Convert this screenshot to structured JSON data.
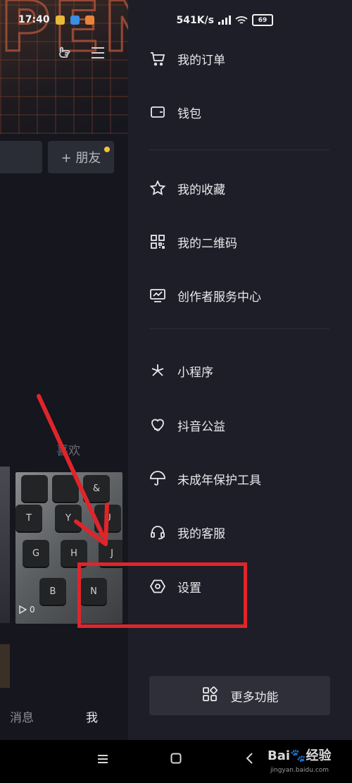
{
  "status_bar": {
    "time": "17:40",
    "network_speed": "541K/s",
    "battery": "69"
  },
  "profile_background": {
    "add_friend_label": "+ 朋友",
    "likes_label": "喜欢",
    "play_count": "0",
    "bottom_tabs": [
      "消息",
      "我"
    ]
  },
  "keyboard_thumb_keys": [
    "&",
    "T",
    "Y",
    "U",
    "G",
    "H",
    "J",
    "B",
    "N"
  ],
  "drawer": {
    "items": [
      {
        "label": "我的订单",
        "icon": "cart-icon"
      },
      {
        "label": "钱包",
        "icon": "wallet-icon"
      },
      {
        "label": "我的收藏",
        "icon": "star-icon"
      },
      {
        "label": "我的二维码",
        "icon": "qr-code-icon"
      },
      {
        "label": "创作者服务中心",
        "icon": "chart-monitor-icon"
      },
      {
        "label": "小程序",
        "icon": "mini-program-icon"
      },
      {
        "label": "抖音公益",
        "icon": "charity-heart-icon"
      },
      {
        "label": "未成年保护工具",
        "icon": "umbrella-icon"
      },
      {
        "label": "我的客服",
        "icon": "headset-icon"
      },
      {
        "label": "设置",
        "icon": "settings-hexagon-icon"
      }
    ],
    "more_button_label": "更多功能"
  },
  "watermark": {
    "brand": "Bai🐾经验",
    "url": "jingyan.baidu.com"
  },
  "colors": {
    "annotation_red": "#e0252a",
    "drawer_bg": "#1d1e27",
    "accent_dot": "#f4c235"
  }
}
